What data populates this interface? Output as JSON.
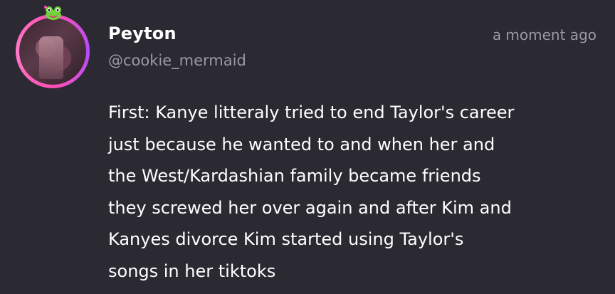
{
  "post": {
    "author_name": "Peyton",
    "author_handle": "@cookie_mermaid",
    "timestamp": "a moment ago",
    "avatar_decoration_icon": "frog-icon",
    "text_lines": [
      "First: Kanye litteraly tried to end Taylor's career",
      "just because he wanted to and when her and",
      "the West/Kardashian family became friends",
      "they screwed her over again and after Kim and",
      "Kanyes divorce Kim started using Taylor's",
      "songs in her tiktoks"
    ]
  },
  "colors": {
    "background": "#2b2a33",
    "primary_text": "#ffffff",
    "secondary_text": "#9a99a6",
    "avatar_ring": "#ff4fb3"
  }
}
